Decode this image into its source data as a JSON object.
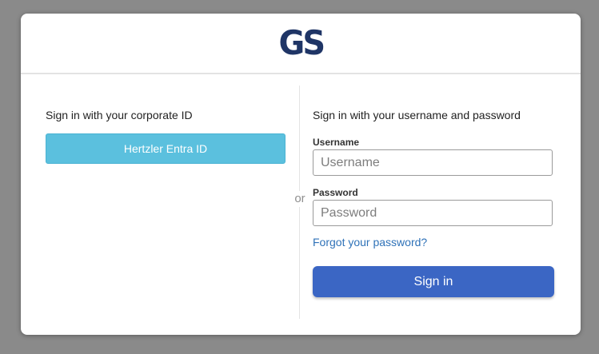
{
  "brand": {
    "logo_text": "GS",
    "logo_color": "#1f3566"
  },
  "corporate": {
    "title": "Sign in with your corporate ID",
    "sso_button_label": "Hertzler Entra ID",
    "sso_button_color": "#5bc0de"
  },
  "separator": {
    "label": "or"
  },
  "credentials": {
    "title": "Sign in with your username and password",
    "username_label": "Username",
    "username_placeholder": "Username",
    "username_value": "",
    "password_label": "Password",
    "password_placeholder": "Password",
    "password_value": "",
    "forgot_link": "Forgot your password?",
    "submit_label": "Sign in",
    "submit_color": "#3b66c4"
  }
}
